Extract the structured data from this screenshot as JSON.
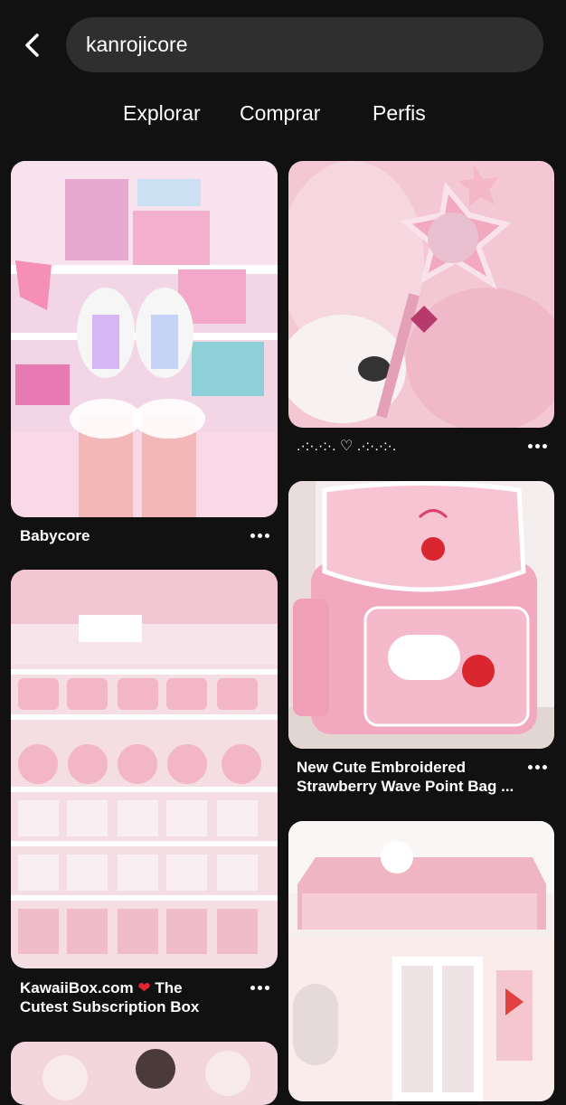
{
  "search": {
    "query": "kanrojicore"
  },
  "tabs": [
    {
      "label": "Explorar"
    },
    {
      "label": "Comprar"
    },
    {
      "label": "Perfis"
    }
  ],
  "pins": [
    {
      "title": "Babycore"
    },
    {
      "title": ".·:·.·:·. ♡ .·:·.·:·."
    },
    {
      "title_line1": "New Cute Embroidered",
      "title_line2": "Strawberry Wave Point Bag ..."
    },
    {
      "title_line1_pre": "KawaiiBox.com",
      "title_heart": "❤",
      "title_line1_post": "The",
      "title_line2": "Cutest Subscription Box"
    }
  ],
  "colors": {
    "background": "#111111",
    "search_bg": "#2f2f2f",
    "text": "#ffffff",
    "heart": "#e32636"
  },
  "icons": [
    "back-arrow-icon",
    "more-options-icon"
  ]
}
